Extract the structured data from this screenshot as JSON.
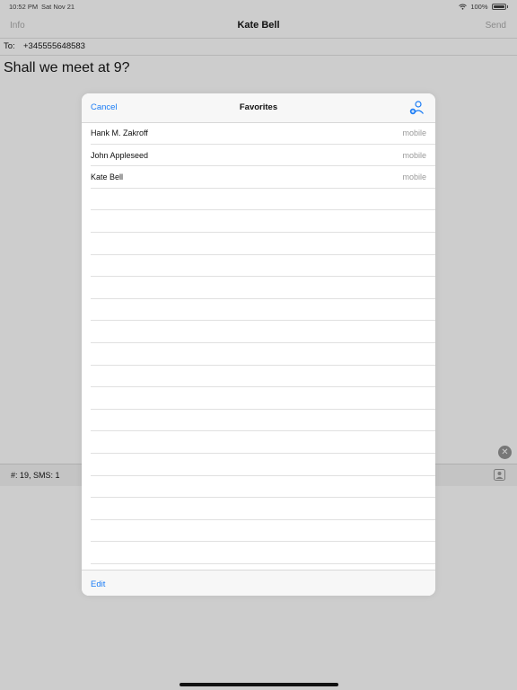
{
  "status_bar": {
    "time": "10:52 PM",
    "date": "Sat Nov 21",
    "battery": "100%"
  },
  "nav": {
    "left": "Info",
    "title": "Kate Bell",
    "right": "Send"
  },
  "recipient": {
    "label": "To:",
    "value": "+345555648583"
  },
  "message": "Shall we meet at 9?",
  "counter": "#: 19, SMS: 1",
  "sheet": {
    "cancel": "Cancel",
    "title": "Favorites",
    "edit": "Edit",
    "contacts": [
      {
        "name": "Hank M. Zakroff",
        "type": "mobile"
      },
      {
        "name": "John Appleseed",
        "type": "mobile"
      },
      {
        "name": "Kate Bell",
        "type": "mobile"
      }
    ],
    "empty_rows": 17
  },
  "colors": {
    "accent": "#1a7cf5",
    "dim_background": "#cdcdcd"
  },
  "icons": {
    "add_contact": "person-plus-icon",
    "clear": "clear-icon",
    "contact": "contact-card-icon",
    "wifi": "wifi-icon",
    "battery": "battery-icon"
  }
}
